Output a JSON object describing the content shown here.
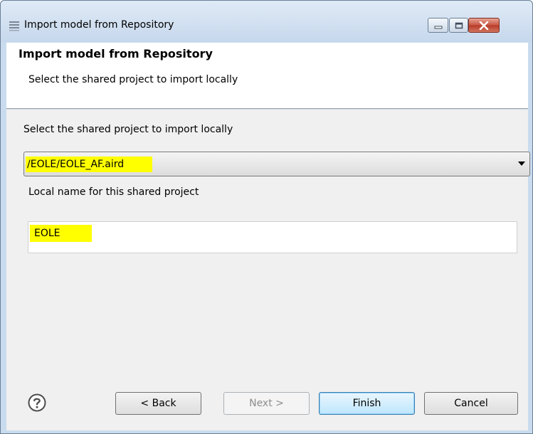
{
  "window": {
    "title": "Import model from Repository"
  },
  "header": {
    "title": "Import model from Repository",
    "subtitle": "Select the shared project to import locally"
  },
  "form": {
    "project_label": "Select the shared project to import locally",
    "project_value": "/EOLE/EOLE_AF.aird",
    "local_name_label": "Local name for this shared project",
    "local_name_value": "EOLE",
    "highlight_color": "#ffff00"
  },
  "buttons": {
    "back": "< Back",
    "next": "Next >",
    "finish": "Finish",
    "cancel": "Cancel"
  },
  "icons": {
    "title": "repository-stack-icon",
    "help": "help-icon"
  }
}
